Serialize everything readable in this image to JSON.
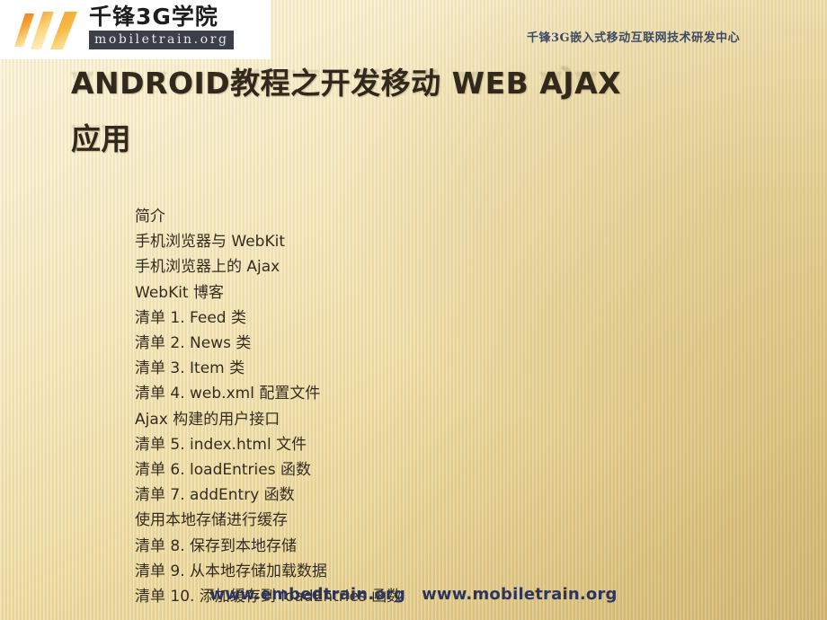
{
  "header": {
    "logo": {
      "mark_name": "qianfeng-logo-mark",
      "brand_cn": "千锋3G学院",
      "brand_url": "mobiletrain.org"
    },
    "org_line": "千锋3G嵌入式移动互联网技术研发中心"
  },
  "title": {
    "line1": "ANDROID教程之开发移动 WEB AJAX",
    "line2": "应用"
  },
  "content": {
    "lines": [
      "简介",
      "手机浏览器与 WebKit",
      "手机浏览器上的 Ajax",
      "WebKit 博客",
      "清单 1. Feed 类",
      "清单 2. News 类",
      "清单 3. Item 类",
      "清单 4. web.xml 配置文件",
      "Ajax 构建的用户接口",
      "清单 5. index.html 文件",
      "清单 6. loadEntries 函数",
      "清单 7. addEntry 函数",
      "使用本地存储进行缓存",
      "清单 8. 保存到本地存储",
      "清单 9. 从本地存储加载数据",
      "清单 10. 添加缓存到 loadEntries 函数"
    ]
  },
  "footer": {
    "link1": "www.embedtrain.org",
    "link2": "www.mobiletrain.org"
  },
  "colors": {
    "title_text": "#30281c",
    "body_text": "#342b1b",
    "footer_link": "#2a3560",
    "org_line": "#3d4a63",
    "logo_badge_bg": "#3a3f4a",
    "accent_orange": "#ef8a24",
    "accent_yellow": "#fbd579",
    "bg_light": "#fdf7dd",
    "bg_dark": "#d5b86e"
  }
}
